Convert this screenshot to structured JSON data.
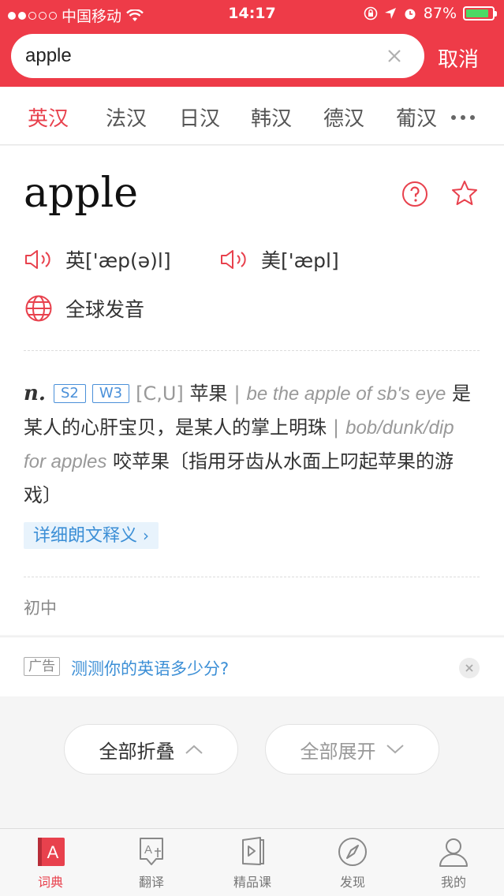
{
  "status": {
    "carrier": "中国移动",
    "time": "14:17",
    "battery": "87%",
    "battery_level": 0.87
  },
  "search": {
    "query": "apple",
    "cancel_label": "取消"
  },
  "tabs": [
    "英汉",
    "法汉",
    "日汉",
    "韩汉",
    "德汉",
    "葡汉"
  ],
  "entry": {
    "word": "apple",
    "uk_pron": "英['æp(ə)l]",
    "us_pron": "美['æpl]",
    "global_pron": "全球发音",
    "pos": "n.",
    "tags": [
      "S2",
      "W3"
    ],
    "grammar": "[C,U]",
    "meaning": "苹果",
    "separator": "|",
    "example1": "be the apple of sb's eye",
    "example1_meaning": "是某人的心肝宝贝，是某人的掌上明珠",
    "example2": "bob/dunk/dip for apples",
    "example2_meaning": "咬苹果〔指用牙齿从水面上叼起苹果的游戏〕",
    "detail_link": "详细朗文释义",
    "level": "初中"
  },
  "ad": {
    "tag": "广告",
    "text": "测测你的英语多少分?"
  },
  "fold": {
    "collapse_all": "全部折叠",
    "expand_all": "全部展开"
  },
  "nav": [
    {
      "label": "词典",
      "icon": "dictionary-icon",
      "active": true
    },
    {
      "label": "翻译",
      "icon": "translate-icon",
      "active": false
    },
    {
      "label": "精品课",
      "icon": "course-icon",
      "active": false
    },
    {
      "label": "发现",
      "icon": "compass-icon",
      "active": false
    },
    {
      "label": "我的",
      "icon": "user-icon",
      "active": false
    }
  ],
  "colors": {
    "brand": "#ee3b48",
    "accent_blue": "#3c8fd6"
  }
}
